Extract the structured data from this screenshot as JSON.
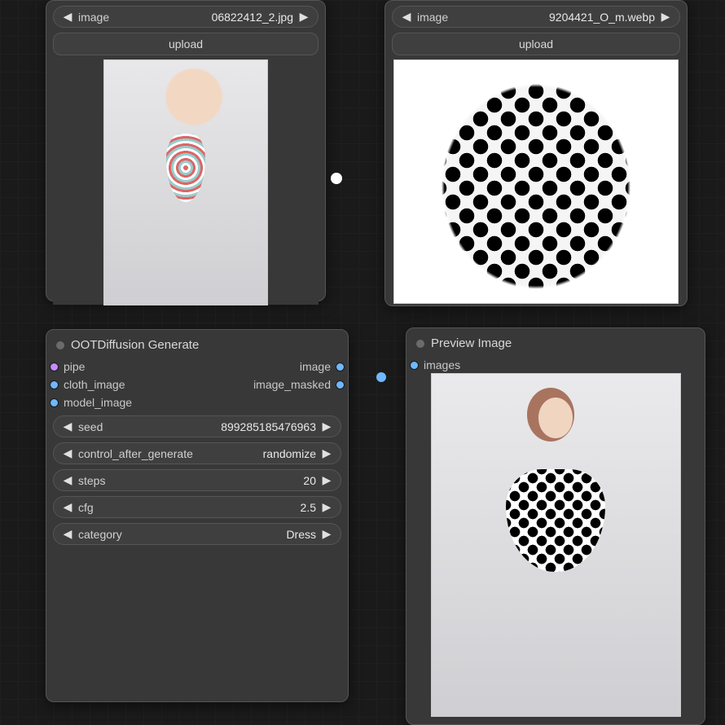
{
  "nodes": {
    "load_model_image": {
      "field_label": "image",
      "field_value": "06822412_2.jpg",
      "upload_label": "upload"
    },
    "load_cloth_image": {
      "field_label": "image",
      "field_value": "9204421_O_m.webp",
      "upload_label": "upload"
    },
    "generate": {
      "title": "OOTDiffusion Generate",
      "inputs": {
        "pipe": "pipe",
        "cloth_image": "cloth_image",
        "model_image": "model_image"
      },
      "outputs": {
        "image": "image",
        "image_masked": "image_masked"
      },
      "params": {
        "seed_label": "seed",
        "seed_value": "899285185476963",
        "cag_label": "control_after_generate",
        "cag_value": "randomize",
        "steps_label": "steps",
        "steps_value": "20",
        "cfg_label": "cfg",
        "cfg_value": "2.5",
        "category_label": "category",
        "category_value": "Dress"
      }
    },
    "preview": {
      "title": "Preview Image",
      "input": "images"
    }
  },
  "arrows": {
    "left": "◀",
    "right": "▶"
  }
}
